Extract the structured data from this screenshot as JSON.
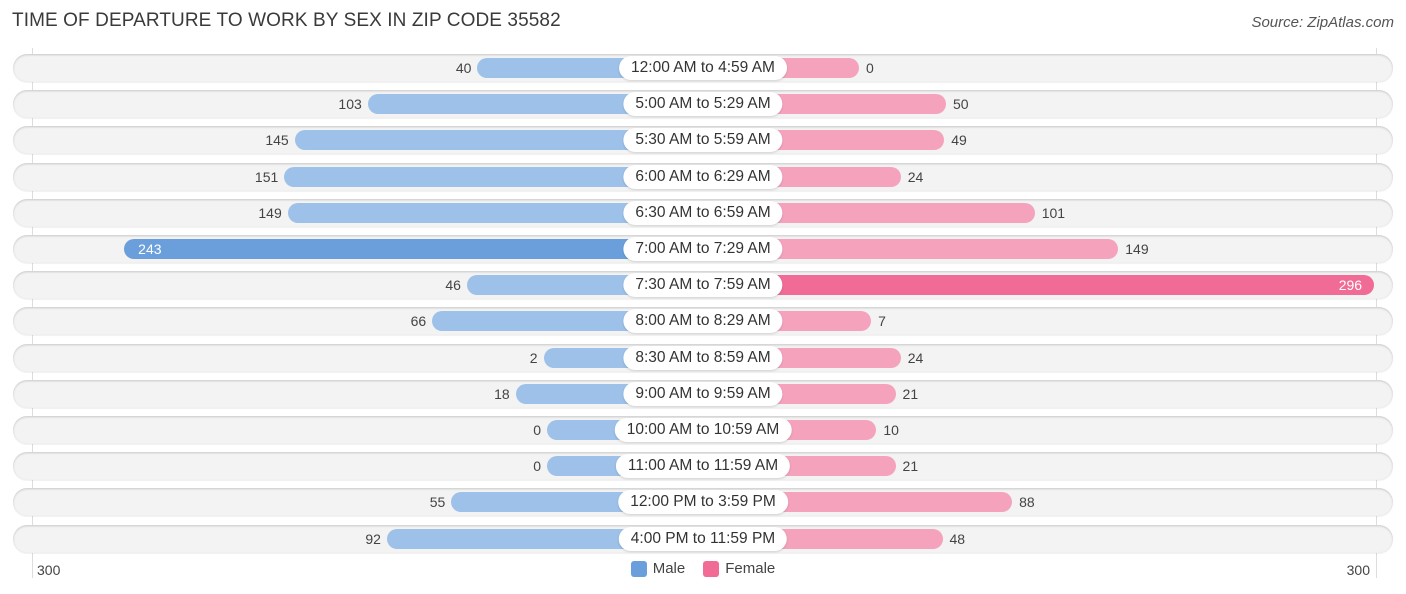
{
  "chart_data": {
    "type": "bar",
    "orientation": "horizontal-diverging",
    "title": "TIME OF DEPARTURE TO WORK BY SEX IN ZIP CODE 35582",
    "source": "Source: ZipAtlas.com",
    "categories": [
      "12:00 AM to 4:59 AM",
      "5:00 AM to 5:29 AM",
      "5:30 AM to 5:59 AM",
      "6:00 AM to 6:29 AM",
      "6:30 AM to 6:59 AM",
      "7:00 AM to 7:29 AM",
      "7:30 AM to 7:59 AM",
      "8:00 AM to 8:29 AM",
      "8:30 AM to 8:59 AM",
      "9:00 AM to 9:59 AM",
      "10:00 AM to 10:59 AM",
      "11:00 AM to 11:59 AM",
      "12:00 PM to 3:59 PM",
      "4:00 PM to 11:59 PM"
    ],
    "series": [
      {
        "name": "Male",
        "color": "#6a9fdb",
        "values": [
          40,
          103,
          145,
          151,
          149,
          243,
          46,
          66,
          2,
          18,
          0,
          0,
          55,
          92
        ]
      },
      {
        "name": "Female",
        "color": "#f06b95",
        "values": [
          0,
          50,
          49,
          24,
          101,
          149,
          296,
          7,
          24,
          21,
          10,
          21,
          88,
          48
        ]
      }
    ],
    "axis": {
      "left_label": "300",
      "right_label": "300",
      "range": [
        0,
        300
      ]
    },
    "legend": {
      "position": "bottom-center",
      "items": [
        "Male",
        "Female"
      ]
    }
  }
}
